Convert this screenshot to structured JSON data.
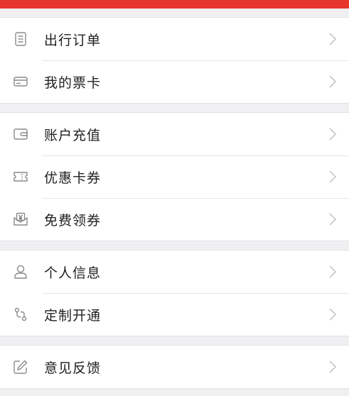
{
  "colors": {
    "accent": "#e8352c",
    "background": "#f0f0f2",
    "icon": "#8a8a8a",
    "chevron": "#c7c7cc",
    "text": "#1f1f1f"
  },
  "groups": [
    {
      "items": [
        {
          "label": "出行订单",
          "icon": "document-list-icon"
        },
        {
          "label": "我的票卡",
          "icon": "card-icon"
        }
      ]
    },
    {
      "items": [
        {
          "label": "账户充值",
          "icon": "wallet-icon"
        },
        {
          "label": "优惠卡券",
          "icon": "coupon-icon"
        },
        {
          "label": "免费领券",
          "icon": "envelope-yuan-icon"
        }
      ]
    },
    {
      "items": [
        {
          "label": "个人信息",
          "icon": "person-icon"
        },
        {
          "label": "定制开通",
          "icon": "route-icon"
        }
      ]
    },
    {
      "items": [
        {
          "label": "意见反馈",
          "icon": "edit-icon"
        }
      ]
    }
  ]
}
